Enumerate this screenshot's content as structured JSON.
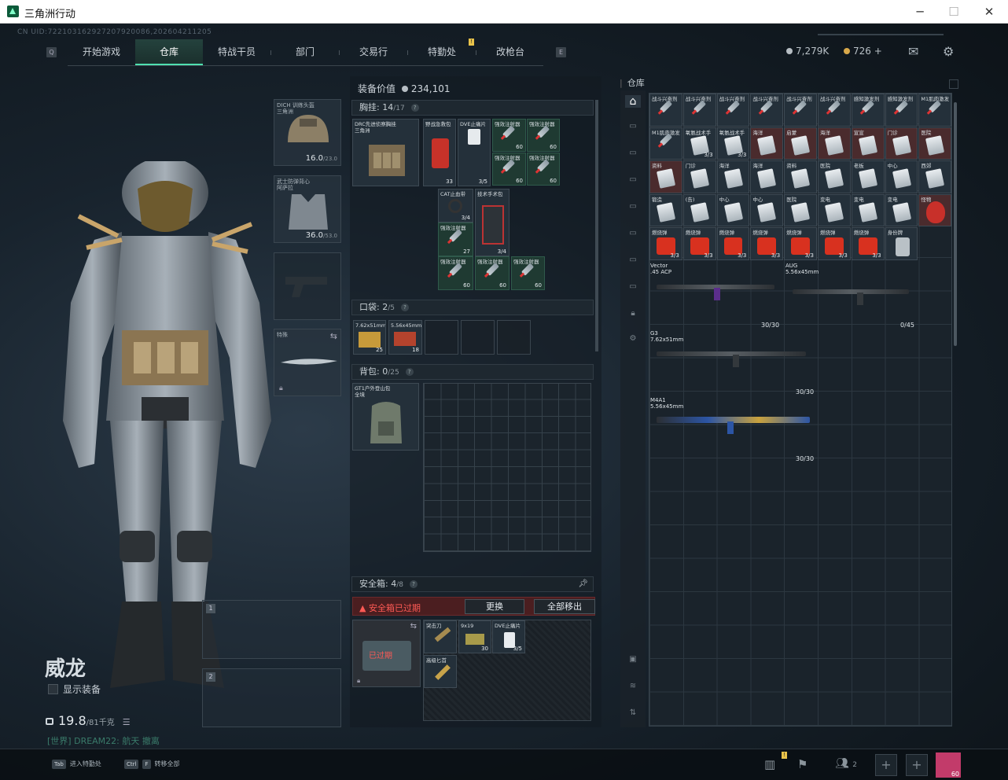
{
  "window": {
    "title": "三角洲行动"
  },
  "uid": "CN UID:722103162927207920086,202604211205",
  "nav": {
    "tabs": [
      "开始游戏",
      "仓库",
      "特战干员",
      "部门",
      "交易行",
      "特勤处",
      "改枪台"
    ],
    "active": "仓库",
    "left_key": "Q",
    "right_key": "E"
  },
  "currency": {
    "money": "7,279K",
    "coin": "726",
    "add": "+"
  },
  "character": {
    "name": "威龙",
    "show_equip": "显示装备",
    "weight": "19.8",
    "weight_max": "/81千克",
    "chat_channel": "[世界]",
    "chat_text": "DREAM22: 航天 撤离"
  },
  "equip_slots": {
    "helmet": {
      "label": "DICH 训练头盔",
      "sub": "三角洲",
      "value": "16.0",
      "max": "/23.0"
    },
    "armor": {
      "label": "武士防弹背心",
      "sub": "阿萨拉",
      "value": "36.0",
      "max": "/53.0"
    },
    "melee": {
      "label": "特殊"
    },
    "slot1": "1",
    "slot2": "2"
  },
  "middle": {
    "value_label": "装备价值",
    "value": "234,101",
    "chest": {
      "title": "胸挂:",
      "count": "14",
      "max": "/17"
    },
    "chest_rig": {
      "label": "DRC先进侦察胸挂",
      "sub": "三角洲"
    },
    "chest_items": [
      {
        "label": "野战急救包",
        "qty": "33",
        "kind": "medkit"
      },
      {
        "label": "DVE止痛片",
        "qty": "3/5",
        "kind": "pills"
      },
      {
        "label": "强效注射器",
        "qty": "60",
        "kind": "syringe"
      },
      {
        "label": "强效注射器",
        "qty": "60",
        "kind": "syringe"
      },
      {
        "label": "强效注射器",
        "qty": "60",
        "kind": "syringe"
      },
      {
        "label": "强效注射器",
        "qty": "60",
        "kind": "syringe"
      },
      {
        "label": "CAT止血带",
        "qty": "3/4",
        "kind": "tourniquet"
      },
      {
        "label": "技术手术包",
        "qty": "3/4",
        "kind": "surgery"
      },
      {
        "label": "强效注射器",
        "qty": "27",
        "kind": "syringe"
      },
      {
        "label": "强效注射器",
        "qty": "60",
        "kind": "syringe"
      },
      {
        "label": "强效注射器",
        "qty": "60",
        "kind": "syringe"
      },
      {
        "label": "强效注射器",
        "qty": "60",
        "kind": "syringe"
      }
    ],
    "pocket": {
      "title": "口袋:",
      "count": "2",
      "max": "/5"
    },
    "pocket_items": [
      {
        "label": "7.62x51mm",
        "qty": "25"
      },
      {
        "label": "5.56x45mm",
        "qty": "18"
      }
    ],
    "backpack": {
      "title": "背包:",
      "count": "0",
      "max": "/25",
      "label": "GT1户外登山包",
      "sub": "全境"
    },
    "safebox": {
      "title": "安全箱:",
      "count": "4",
      "max": "/8",
      "warning": "安全箱已过期",
      "change": "更换",
      "move_all": "全部移出",
      "expired": "已过期",
      "items": [
        {
          "label": "突击刀",
          "qty": ""
        },
        {
          "label": "9x19",
          "qty": "30"
        },
        {
          "label": "DVE止痛片",
          "qty": "3/5"
        },
        {
          "label": "高级匕首",
          "qty": ""
        }
      ]
    }
  },
  "warehouse": {
    "title": "仓库",
    "items": [
      {
        "label": "战斗兴奋剂",
        "qty": "",
        "kind": "syringe"
      },
      {
        "label": "战斗兴奋剂",
        "qty": "",
        "kind": "syringe"
      },
      {
        "label": "战斗兴奋剂",
        "qty": "",
        "kind": "syringe"
      },
      {
        "label": "战斗兴奋剂",
        "qty": "",
        "kind": "syringe"
      },
      {
        "label": "战斗兴奋剂",
        "qty": "",
        "kind": "syringe"
      },
      {
        "label": "战斗兴奋剂",
        "qty": "",
        "kind": "syringe"
      },
      {
        "label": "感知激发剂",
        "qty": "",
        "kind": "syringe"
      },
      {
        "label": "感知激发剂",
        "qty": "",
        "kind": "syringe"
      },
      {
        "label": "M1肌肉激发",
        "qty": "",
        "kind": "syringe"
      },
      {
        "label": "M1肌肉激发",
        "qty": "",
        "kind": "syringe"
      },
      {
        "label": "氧氨战术手",
        "qty": "3/3",
        "kind": "pack"
      },
      {
        "label": "氧氨战术手",
        "qty": "3/3",
        "kind": "pack"
      },
      {
        "label": "海洋",
        "qty": "",
        "kind": "pack",
        "red": true
      },
      {
        "label": "启蒙",
        "qty": "",
        "kind": "pack",
        "red": true
      },
      {
        "label": "海洋",
        "qty": "",
        "kind": "pack",
        "red": true
      },
      {
        "label": "宣宣",
        "qty": "",
        "kind": "pack",
        "red": true
      },
      {
        "label": "门诊",
        "qty": "",
        "kind": "pack",
        "red": true
      },
      {
        "label": "医院",
        "qty": "",
        "kind": "pack",
        "red": true
      },
      {
        "label": "资料",
        "qty": "",
        "kind": "pack",
        "red": true
      },
      {
        "label": "门诊",
        "qty": "",
        "kind": "pack"
      },
      {
        "label": "海洋",
        "qty": "",
        "kind": "pack"
      },
      {
        "label": "海洋",
        "qty": "",
        "kind": "pack"
      },
      {
        "label": "资料",
        "qty": "",
        "kind": "pack"
      },
      {
        "label": "医院",
        "qty": "",
        "kind": "pack"
      },
      {
        "label": "老板",
        "qty": "",
        "kind": "pack"
      },
      {
        "label": "中心",
        "qty": "",
        "kind": "pack"
      },
      {
        "label": "西郊",
        "qty": "",
        "kind": "pack"
      },
      {
        "label": "锻造",
        "qty": "",
        "kind": "pack"
      },
      {
        "label": "(告)",
        "qty": "",
        "kind": "pack"
      },
      {
        "label": "中心",
        "qty": "",
        "kind": "pack"
      },
      {
        "label": "中心",
        "qty": "",
        "kind": "pack"
      },
      {
        "label": "医院",
        "qty": "",
        "kind": "pack"
      },
      {
        "label": "变电",
        "qty": "",
        "kind": "pack"
      },
      {
        "label": "变电",
        "qty": "",
        "kind": "pack"
      },
      {
        "label": "变电",
        "qty": "",
        "kind": "pack"
      },
      {
        "label": "怪物",
        "qty": "",
        "kind": "mask",
        "red": true
      },
      {
        "label": "燃烧弹",
        "qty": "3/3",
        "kind": "red"
      },
      {
        "label": "燃烧弹",
        "qty": "3/3",
        "kind": "red"
      },
      {
        "label": "燃烧弹",
        "qty": "3/3",
        "kind": "red"
      },
      {
        "label": "燃烧弹",
        "qty": "3/3",
        "kind": "red"
      },
      {
        "label": "燃烧弹",
        "qty": "3/3",
        "kind": "red"
      },
      {
        "label": "燃烧弹",
        "qty": "3/3",
        "kind": "red"
      },
      {
        "label": "燃烧弹",
        "qty": "3/3",
        "kind": "red"
      },
      {
        "label": "身份牌",
        "qty": "",
        "kind": "tag"
      }
    ],
    "guns": [
      {
        "name": "Vector",
        ".": "",
        "ammo": ".45 ACP",
        "mag": "30/30"
      },
      {
        "name": "AUG",
        "ammo": "5.56x45mm",
        "mag": "0/45"
      },
      {
        "name": "G3",
        "ammo": "7.62x51mm",
        "mag": "30/30"
      },
      {
        "name": "M4A1",
        "ammo": "5.56x45mm",
        "mag": "30/30"
      }
    ]
  },
  "bottom": {
    "tab_key": "Tab",
    "tab_text": "进入特勤处",
    "ctrl_key": "Ctrl",
    "f_key": "F",
    "ctrl_text": "转移全部",
    "friends": "2",
    "level": "60"
  },
  "colors": {
    "accent": "#4fe0b0",
    "warning": "#ff5a55",
    "coin_gold": "#d8a84a"
  }
}
